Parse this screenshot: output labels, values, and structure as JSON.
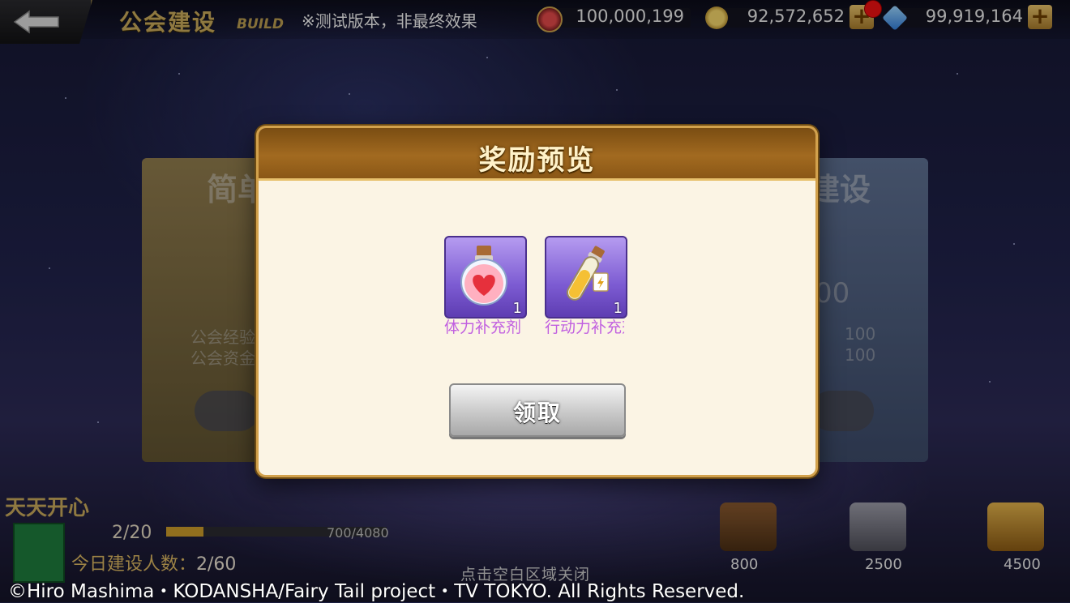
{
  "topbar": {
    "title": "公会建设",
    "title_sub": "BUILD",
    "notice": "※测试版本，非最终效果",
    "resources": [
      {
        "icon": "heart-icon",
        "value": "100,000,199"
      },
      {
        "icon": "coin-icon",
        "value": "92,572,652"
      },
      {
        "icon": "diamond-icon",
        "value": "99,919,164"
      }
    ]
  },
  "background": {
    "left_card_title": "简单",
    "left_card_rows": [
      "公会经验",
      "公会资金"
    ],
    "right_card_title": "建设",
    "right_card_values": [
      "00",
      "100",
      "100"
    ],
    "guild_name": "天天开心",
    "level": "2/20",
    "exp_text": "700/4080",
    "exp_fraction": 0.17,
    "today_label": "今日建设人数：",
    "today_value": "2/60",
    "chests": [
      "800",
      "2500",
      "4500"
    ],
    "close_hint": "点击空白区域关闭",
    "copyright": "©Hiro Mashima・KODANSHA/Fairy Tail project・TV TOKYO. All Rights Reserved."
  },
  "modal": {
    "title": "奖励预览",
    "items": [
      {
        "icon": "heart-potion-icon",
        "name": "体力补充剂",
        "count": "1"
      },
      {
        "icon": "energy-vial-icon",
        "name": "行动力补充剂",
        "count": "1"
      }
    ],
    "claim_label": "领取"
  },
  "colors": {
    "gold_title": "#c7a85a",
    "modal_header": "#a26a20",
    "item_name": "#c160e0"
  }
}
